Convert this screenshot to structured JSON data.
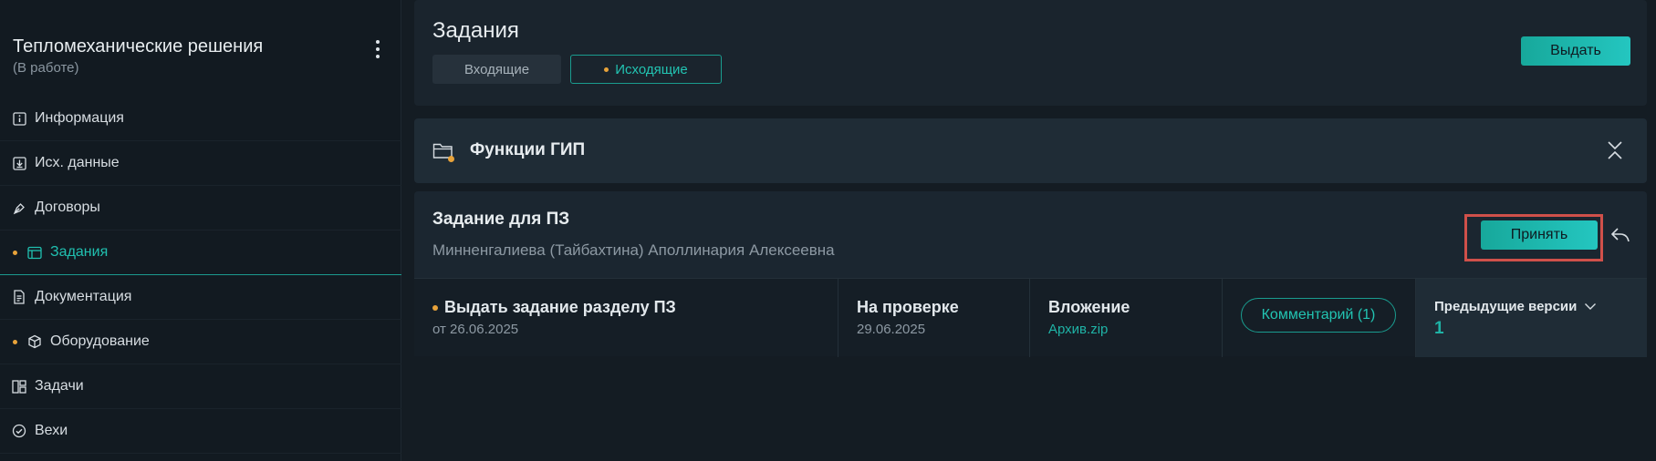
{
  "project": {
    "title": "Тепломеханические решения",
    "status": "(В работе)"
  },
  "sidebar": {
    "items": [
      {
        "label": "Информация",
        "icon": "info-icon",
        "dot": false,
        "active": false
      },
      {
        "label": "Исх. данные",
        "icon": "download-icon",
        "dot": false,
        "active": false
      },
      {
        "label": "Договоры",
        "icon": "pen-icon",
        "dot": false,
        "active": false
      },
      {
        "label": "Задания",
        "icon": "window-icon",
        "dot": true,
        "active": true
      },
      {
        "label": "Документация",
        "icon": "document-icon",
        "dot": false,
        "active": false
      },
      {
        "label": "Оборудование",
        "icon": "box-icon",
        "dot": true,
        "active": false
      },
      {
        "label": "Задачи",
        "icon": "kanban-icon",
        "dot": false,
        "active": false
      },
      {
        "label": "Вехи",
        "icon": "check-circle-icon",
        "dot": false,
        "active": false
      }
    ]
  },
  "header": {
    "title": "Задания",
    "tab_incoming": "Входящие",
    "tab_outgoing": "Исходящие",
    "issue_label": "Выдать"
  },
  "group": {
    "title": "Функции ГИП"
  },
  "task": {
    "title": "Задание для ПЗ",
    "author": "Минненгалиева (Тайбахтина) Аполлинария Алексеевна",
    "accept_label": "Принять",
    "row": {
      "name": "Выдать задание разделу ПЗ",
      "date": "от 26.06.2025",
      "status_label": "На проверке",
      "status_date": "29.06.2025",
      "attachment_label": "Вложение",
      "attachment_file": "Архив.zip",
      "comment_label": "Комментарий (1)",
      "prev_versions_label": "Предыдущие версии",
      "prev_versions_count": "1"
    }
  },
  "colors": {
    "accent": "#20c0b0",
    "dot": "#e8a33a",
    "highlight": "#d0504a"
  }
}
